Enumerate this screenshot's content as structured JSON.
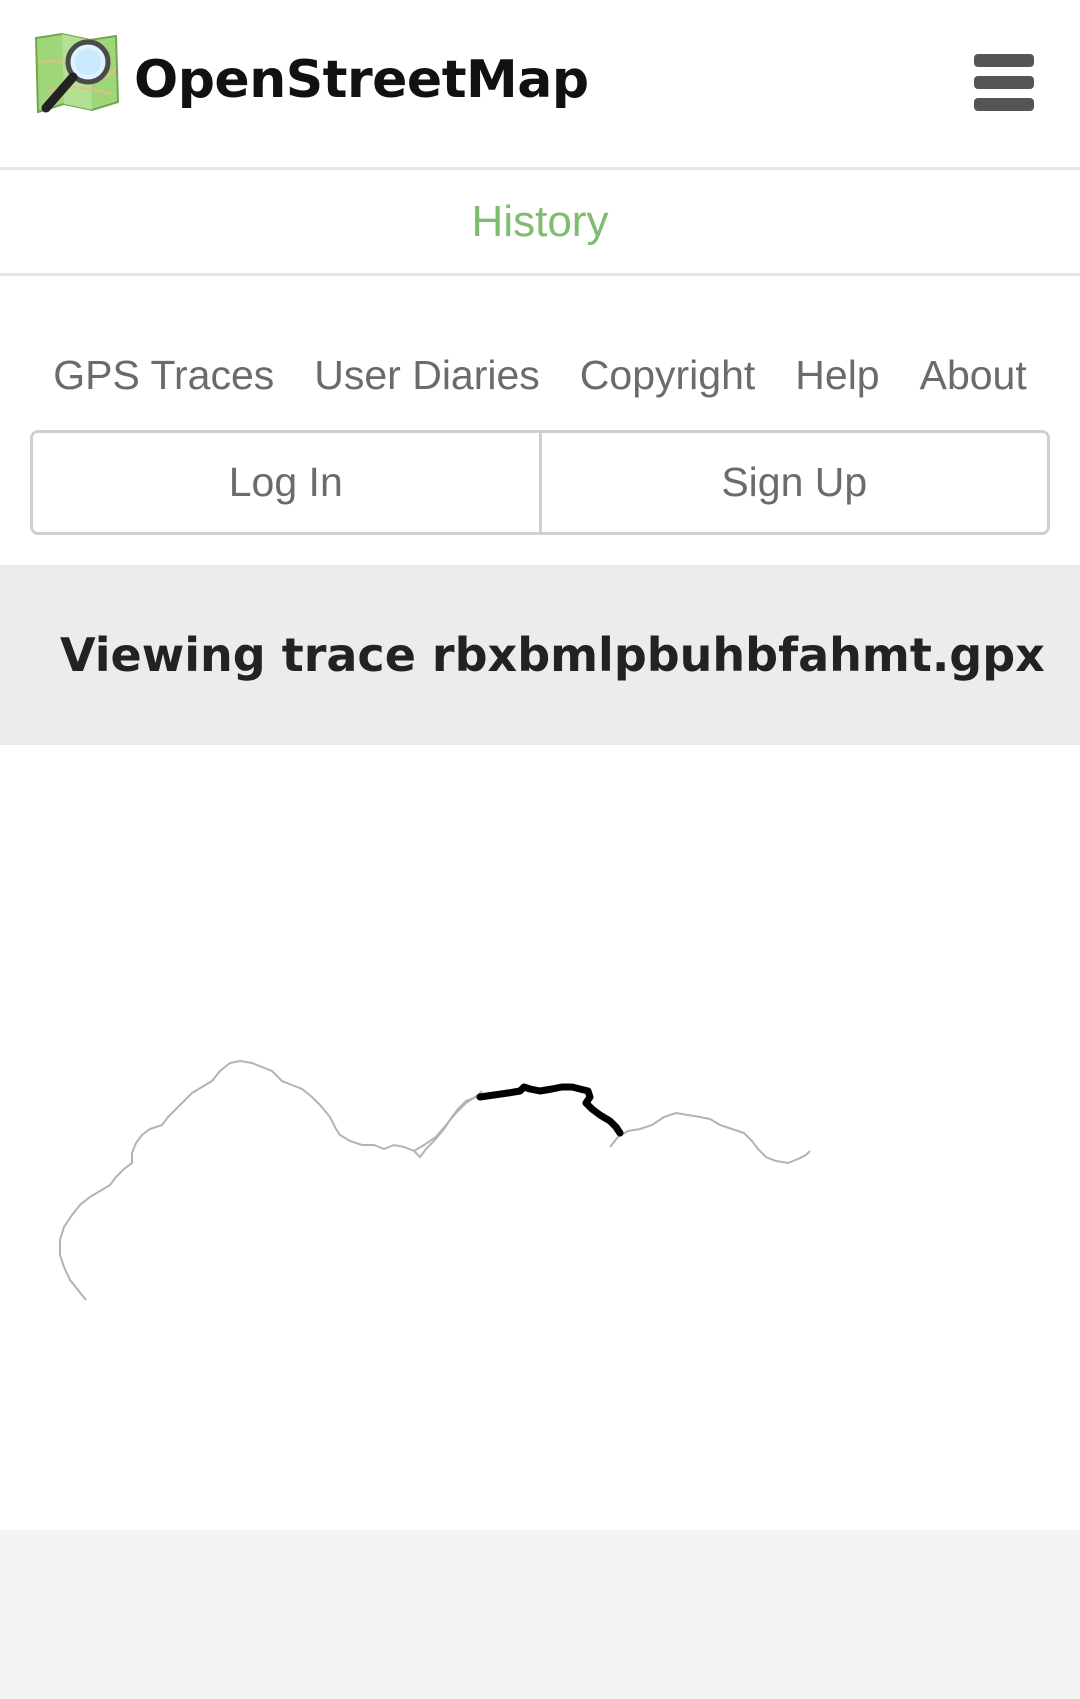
{
  "header": {
    "brand": "OpenStreetMap",
    "logo_icon": "openstreetmap-logo-icon",
    "menu_icon": "hamburger-menu-icon"
  },
  "tabs": {
    "history": "History"
  },
  "nav": {
    "gps_traces": "GPS Traces",
    "user_diaries": "User Diaries",
    "copyright": "Copyright",
    "help": "Help",
    "about": "About"
  },
  "auth": {
    "login": "Log In",
    "signup": "Sign Up"
  },
  "page": {
    "title": "Viewing trace rbxbmlpbuhbfahmt.gpx"
  },
  "colors": {
    "accent_green": "#7ebc6f",
    "muted_text": "#6b6b6b",
    "trace_gray": "#b3b3b3",
    "trace_highlight": "#000000"
  }
}
